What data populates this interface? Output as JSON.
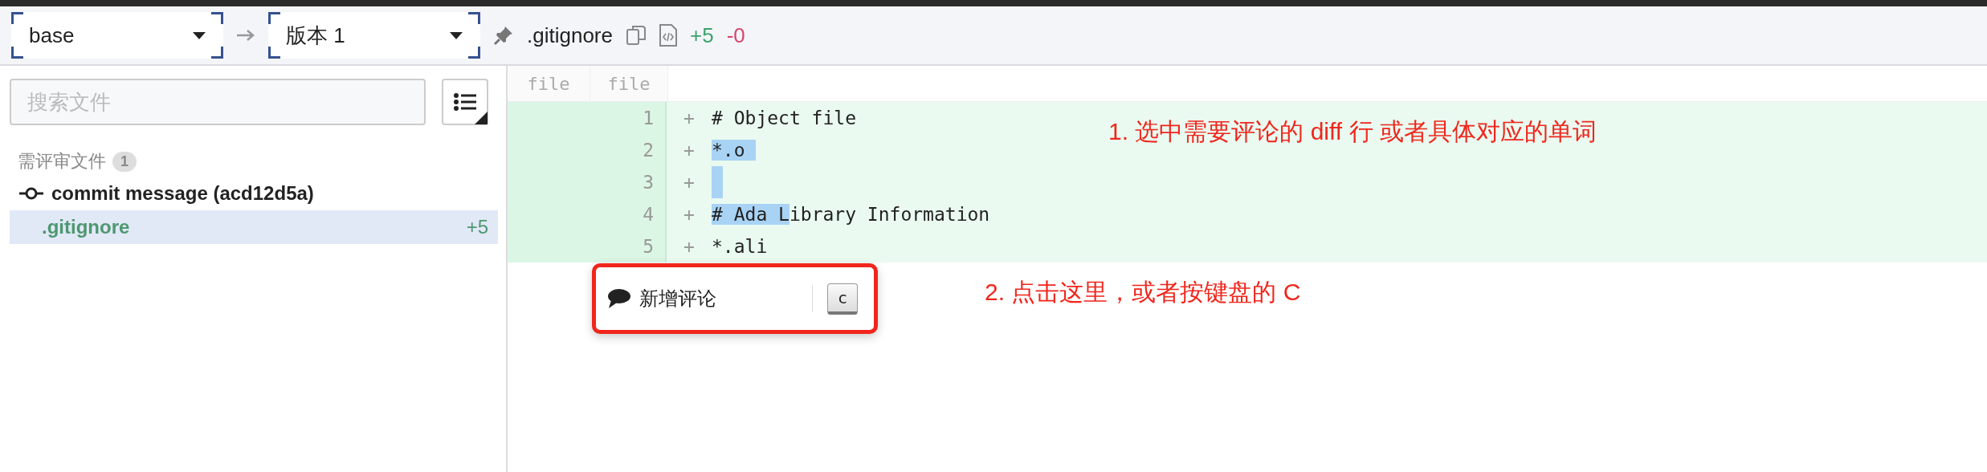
{
  "toolbar": {
    "base_select": {
      "value": "base"
    },
    "target_select": {
      "value": "版本 1"
    },
    "file_name": ".gitignore",
    "additions": "+5",
    "deletions": "-0"
  },
  "sidebar": {
    "search": {
      "placeholder": "搜索文件"
    },
    "section": {
      "title": "需评审文件",
      "count": "1"
    },
    "tree": [
      {
        "label": "commit message (acd12d5a)",
        "kind": "commit",
        "selected": false,
        "children": [
          {
            "label": ".gitignore",
            "kind": "file",
            "selected": true,
            "additions": "+5"
          }
        ]
      }
    ]
  },
  "diff": {
    "columns": [
      "file",
      "file"
    ],
    "lines": [
      {
        "number": "1",
        "sign": "+",
        "segments": [
          {
            "kind": "text",
            "text": "# Object file",
            "selected": false
          }
        ]
      },
      {
        "number": "2",
        "sign": "+",
        "segments": [
          {
            "kind": "text",
            "text": "*.o ",
            "selected": true
          }
        ]
      },
      {
        "number": "3",
        "sign": "+",
        "segments": [
          {
            "kind": "blank",
            "selected": true
          }
        ]
      },
      {
        "number": "4",
        "sign": "+",
        "segments": [
          {
            "kind": "text",
            "text": "# Ada L",
            "selected": true
          },
          {
            "kind": "text",
            "text": "ibrary Information",
            "selected": false
          }
        ]
      },
      {
        "number": "5",
        "sign": "+",
        "segments": [
          {
            "kind": "text",
            "text": "*.ali",
            "selected": false
          }
        ]
      }
    ]
  },
  "popup": {
    "action": "新增评论",
    "shortcut": "c"
  },
  "annotations": [
    "1. 选中需要评论的 diff 行 或者具体对应的单词",
    "2. 点击这里，或者按键盘的 C"
  ]
}
